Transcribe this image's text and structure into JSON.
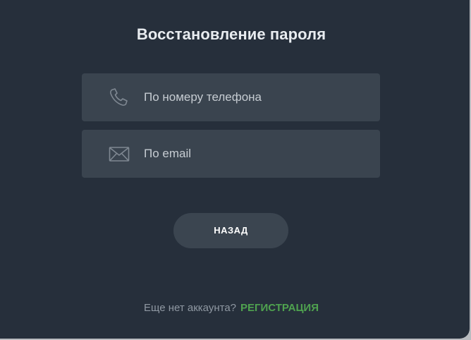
{
  "title": "Восстановление пароля",
  "options": {
    "phone": {
      "label": "По номеру телефона",
      "icon": "phone-icon"
    },
    "email": {
      "label": "По email",
      "icon": "envelope-icon"
    }
  },
  "back_button": {
    "label": "НАЗАД"
  },
  "footer": {
    "question": "Еще нет аккаунта?",
    "register_link": "РЕГИСТРАЦИЯ"
  },
  "colors": {
    "background": "#262f3b",
    "option_bg": "#3a444f",
    "accent_green": "#4fa24f",
    "text_primary": "#e8ecf0",
    "text_muted": "#8f98a2"
  }
}
